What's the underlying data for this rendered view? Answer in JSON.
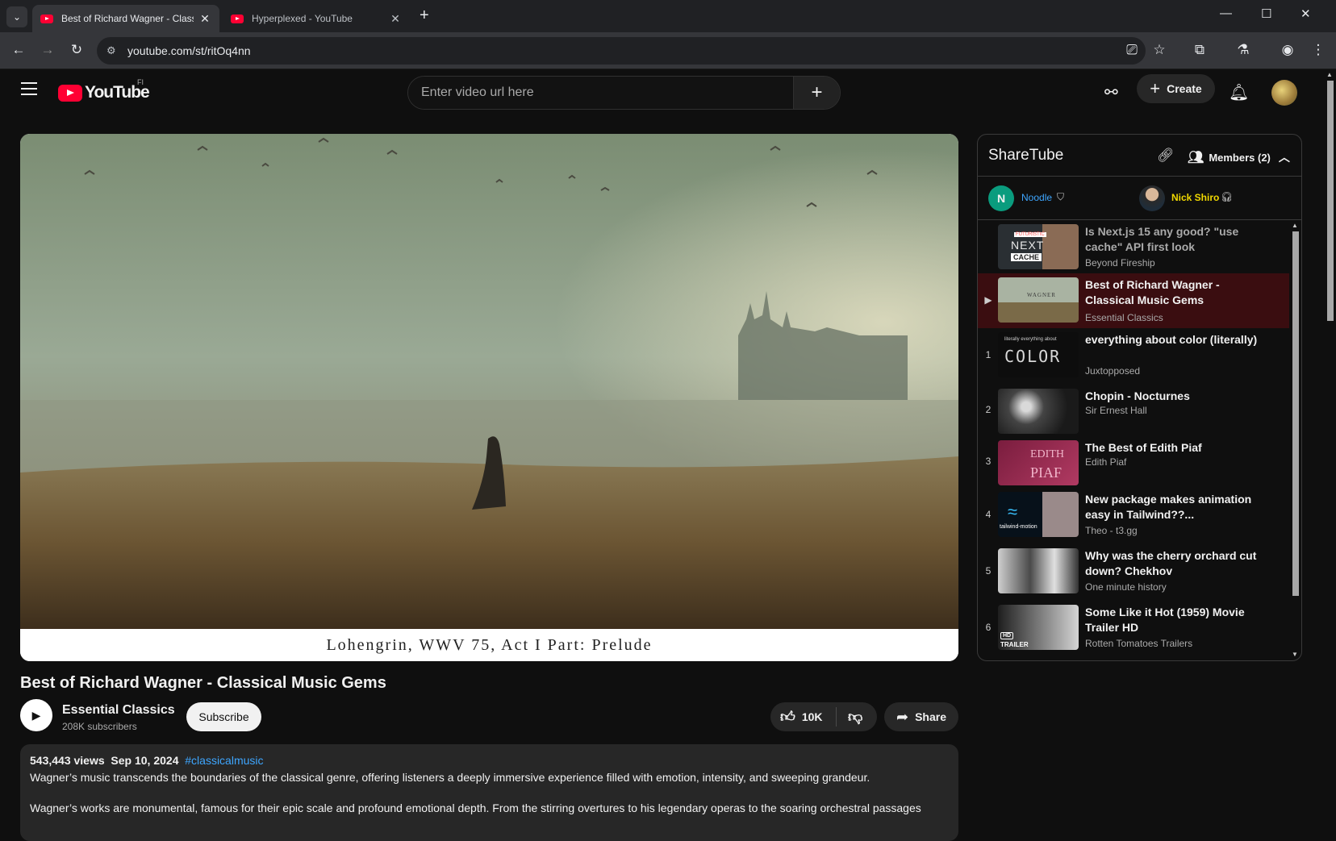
{
  "browser": {
    "tabs": [
      {
        "title": "Best of Richard Wagner - Classical Music Gems",
        "active": true
      },
      {
        "title": "Hyperplexed - YouTube",
        "active": false
      }
    ],
    "url": "youtube.com/st/ritOq4nn"
  },
  "header": {
    "logo_text": "YouTube",
    "logo_region": "FI",
    "search_placeholder": "Enter video url here",
    "create_label": "Create"
  },
  "player": {
    "caption": "Lohengrin, WWV 75, Act I  Part: Prelude"
  },
  "video": {
    "title": "Best of Richard Wagner - Classical Music Gems",
    "channel": "Essential Classics",
    "subscribers": "208K subscribers",
    "subscribe_label": "Subscribe",
    "likes": "10K",
    "share_label": "Share",
    "views": "543,443 views",
    "date": "Sep 10, 2024",
    "hashtag": "#classicalmusic",
    "description_1": "Wagner’s music transcends the boundaries of the classical genre, offering listeners a deeply immersive experience filled with emotion, intensity, and sweeping grandeur.",
    "description_2": "Wagner’s works are monumental, famous for their epic scale and profound emotional depth. From the stirring overtures to his legendary operas to the soaring orchestral passages"
  },
  "sharetube": {
    "title": "ShareTube",
    "members_label": "Members (2)",
    "users": [
      {
        "initial": "N",
        "name": "Noodle",
        "color": "#0a9c7e"
      },
      {
        "name": "Nick Shiro"
      }
    ],
    "queue": [
      {
        "num": "",
        "title": "Is Next.js 15 any good? \"use cache\" API first look",
        "channel": "Beyond Fireship",
        "state": "played"
      },
      {
        "num": "▶",
        "title": "Best of Richard Wagner - Classical Music Gems",
        "channel": "Essential Classics",
        "state": "current"
      },
      {
        "num": "1",
        "title": "everything about color (literally)",
        "channel": "Juxtopposed",
        "state": "queued"
      },
      {
        "num": "2",
        "title": "Chopin - Nocturnes",
        "channel": "Sir Ernest Hall",
        "state": "queued"
      },
      {
        "num": "3",
        "title": "The Best of Edith Piaf",
        "channel": "Edith Piaf",
        "state": "queued"
      },
      {
        "num": "4",
        "title": "New package makes animation easy in Tailwind??...",
        "channel": "Theo - t3.gg",
        "state": "queued"
      },
      {
        "num": "5",
        "title": "Why was the cherry orchard cut down? Chekhov",
        "channel": "One minute history",
        "state": "queued"
      },
      {
        "num": "6",
        "title": "Some Like it Hot (1959) Movie Trailer HD",
        "channel": "Rotten Tomatoes Trailers",
        "state": "queued"
      }
    ],
    "thumb_text": {
      "next": "NEXT",
      "cache": "CACHE",
      "futuristic": "FUTURISTIC",
      "wagner": "WAGNER",
      "color_small": "literally everything about",
      "color": "COLOR",
      "edith": "EDITH",
      "piaf": "PIAF",
      "tailwind": "tailwind-motion",
      "hd": "HD",
      "trailer": "TRAILER"
    }
  },
  "colors": {
    "accent": "#ff0033",
    "link": "#3ea6ff",
    "current_row": "#3a0d10",
    "nick_name": "#f0d800"
  }
}
